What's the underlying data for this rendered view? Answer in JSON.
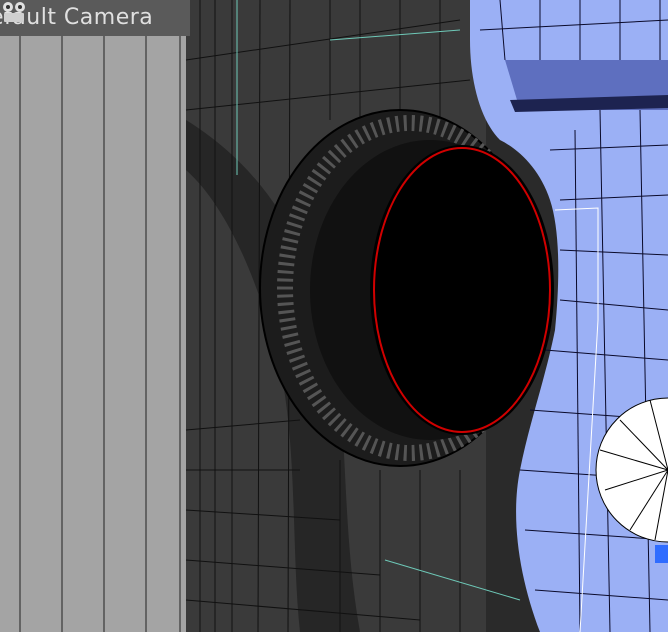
{
  "viewport": {
    "camera_label": "efault Camera",
    "camera_icon": "camera-icon",
    "colors": {
      "background_panel": "#9e9e9e",
      "dark_body": "#3a3a3a",
      "blue_body": "#9bb0f5",
      "wire": "#000000",
      "selection": "#d00000",
      "header": "#5a5a5a"
    }
  }
}
